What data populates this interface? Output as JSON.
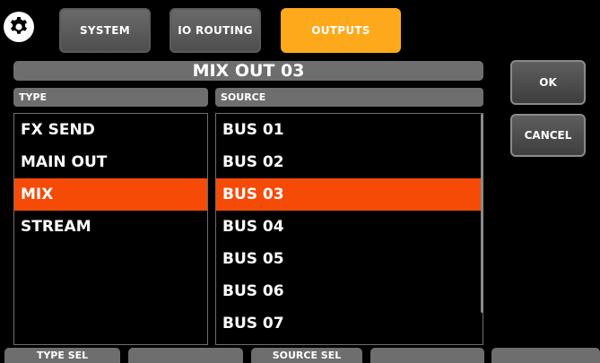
{
  "tabs": [
    {
      "label": "SYSTEM",
      "active": false
    },
    {
      "label": "IO ROUTING",
      "active": false
    },
    {
      "label": "OUTPUTS",
      "active": true
    }
  ],
  "title": "MIX OUT 03",
  "type_header": "TYPE",
  "source_header": "SOURCE",
  "type_items": [
    "FX SEND",
    "MAIN OUT",
    "MIX",
    "STREAM"
  ],
  "type_selected": "MIX",
  "source_items": [
    "BUS 01",
    "BUS 02",
    "BUS 03",
    "BUS 04",
    "BUS 05",
    "BUS 06",
    "BUS 07"
  ],
  "source_selected": "BUS 03",
  "buttons": {
    "ok": "OK",
    "cancel": "CANCEL"
  },
  "footer": [
    "TYPE SEL",
    "",
    "SOURCE SEL",
    "",
    ""
  ],
  "colors": {
    "active_tab": "#fda91b",
    "selection": "#f64a07",
    "panel": "#6e6e6e"
  },
  "icons": {
    "settings": "gear-icon"
  }
}
